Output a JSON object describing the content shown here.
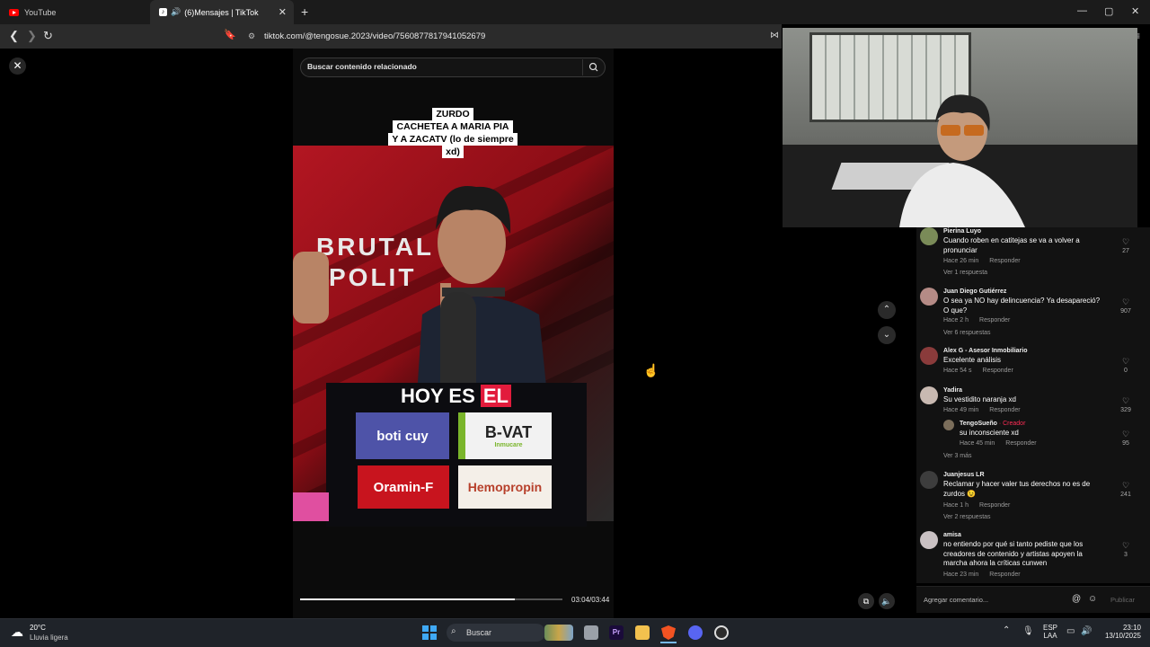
{
  "browser": {
    "tabs": [
      {
        "label": "YouTube",
        "active": false
      },
      {
        "label": "(6)Mensajes | TikTok",
        "active": true
      }
    ],
    "url": "tiktok.com/@tengosue.2023/video/7560877817941052679"
  },
  "tiktok": {
    "search_placeholder": "Buscar contenido relacionado",
    "caption_lines": [
      "ZURDO",
      "CACHETEA A MARIA PIA",
      "Y A ZACATV (lo de siempre",
      "xd)"
    ],
    "video_text": {
      "brutal": [
        "BRUTAL",
        "POLIT"
      ],
      "hoy_es": "HOY ES",
      "el": "EL",
      "sponsors": [
        "boti cuy",
        "B-VAT",
        "Oramin-F",
        "Hemopropin"
      ],
      "sponsor_sub": "Inmucare"
    },
    "progress": 0.82,
    "time": "03:04/03:44",
    "comment_placeholder": "Agregar comentario...",
    "publish_label": "Publicar",
    "comments": [
      {
        "user": "Pierina Luyo",
        "text": "Cuando roben en catitejas se va a volver a pronunciar",
        "time": "Hace 26 min",
        "reply": "Responder",
        "likes": "27",
        "replies": "Ver 1 respuesta"
      },
      {
        "user": "Juan Diego Gutiérrez",
        "text": "O sea ya NO hay delincuencia? Ya desapareció? O que?",
        "time": "Hace 2 h",
        "reply": "Responder",
        "likes": "907",
        "replies": "Ver 6 respuestas"
      },
      {
        "user": "Alex G - Asesor Inmobiliario",
        "text": "Excelente análisis",
        "time": "Hace 54 s",
        "reply": "Responder",
        "likes": "0",
        "replies": ""
      },
      {
        "user": "Yadira",
        "text": "Su vestidito naranja xd",
        "time": "Hace 49 min",
        "reply": "Responder",
        "likes": "329",
        "replies": ""
      },
      {
        "user": "Juanjesus LR",
        "text": "Reclamar y hacer valer tus derechos no es de zurdos 😉",
        "time": "Hace 1 h",
        "reply": "Responder",
        "likes": "241",
        "replies": "Ver 2 respuestas"
      },
      {
        "user": "amisa",
        "text": "no entiendo por qué si tanto pediste que los creadores de contenido y artistas apoyen la marcha ahora la críticas cunwen",
        "time": "Hace 23 min",
        "reply": "Responder",
        "likes": "3",
        "replies": ""
      }
    ],
    "nested_reply": {
      "user": "TengoSueño",
      "badge": "· Creador",
      "text": "su inconsciente xd",
      "time": "Hace 45 min",
      "reply": "Responder",
      "likes": "95",
      "more": "Ver 3 más"
    }
  },
  "taskbar": {
    "weather_temp": "20°C",
    "weather_desc": "Lluvia ligera",
    "search_label": "Buscar",
    "lang": "ESP",
    "lang_sub": "LAA",
    "time": "23:10",
    "date": "13/10/2025"
  }
}
